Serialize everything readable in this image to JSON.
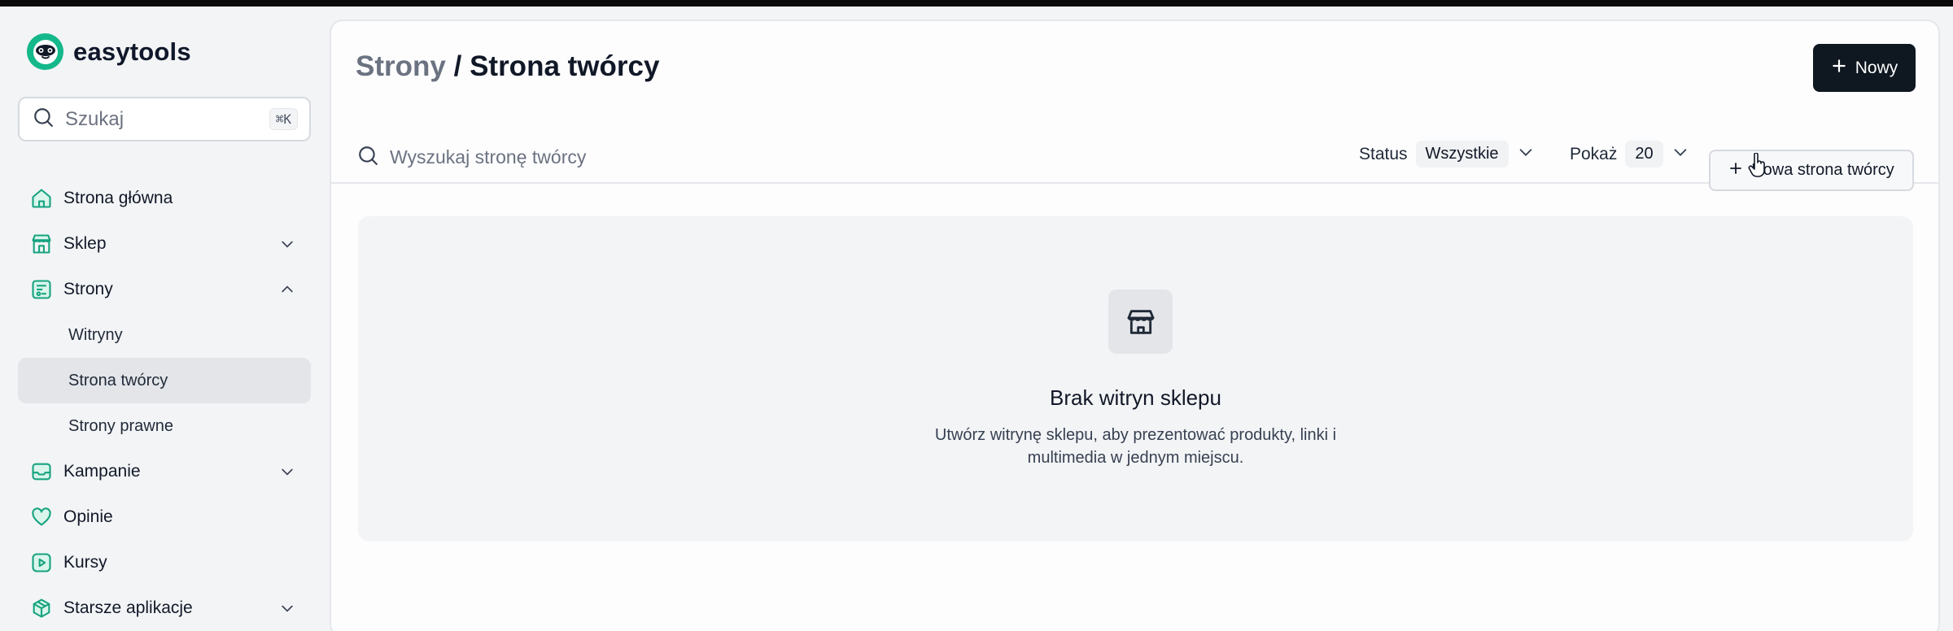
{
  "brand": {
    "name": "easytools"
  },
  "sidebar": {
    "search_placeholder": "Szukaj",
    "search_shortcut": "⌘K",
    "items": [
      {
        "label": "Strona główna",
        "icon": "home-icon"
      },
      {
        "label": "Sklep",
        "icon": "store-icon",
        "chevron": "down"
      },
      {
        "label": "Strony",
        "icon": "pages-icon",
        "chevron": "up"
      },
      {
        "label": "Kampanie",
        "icon": "mail-icon",
        "chevron": "down"
      },
      {
        "label": "Opinie",
        "icon": "heart-icon"
      },
      {
        "label": "Kursy",
        "icon": "play-icon"
      },
      {
        "label": "Starsze aplikacje",
        "icon": "box-icon",
        "chevron": "down"
      }
    ],
    "subitems": [
      {
        "label": "Witryny",
        "active": false
      },
      {
        "label": "Strona twórcy",
        "active": true
      },
      {
        "label": "Strony prawne",
        "active": false
      }
    ]
  },
  "header": {
    "breadcrumb": "Strony",
    "separator": "/",
    "title": "Strona twórcy",
    "new_button": "Nowy"
  },
  "toolbar": {
    "search_placeholder": "Wyszukaj stronę twórcy",
    "status_label": "Status",
    "status_value": "Wszystkie",
    "show_label": "Pokaż",
    "show_value": "20",
    "new_page_button": "Nowa strona twórcy"
  },
  "empty_state": {
    "title": "Brak witryn sklepu",
    "description": "Utwórz witrynę sklepu, aby prezentować produkty, linki i multimedia w jednym miejscu."
  },
  "colors": {
    "accent": "#14b88a",
    "primary_button": "#0f1720",
    "active_nav": "#e3e5e9"
  }
}
